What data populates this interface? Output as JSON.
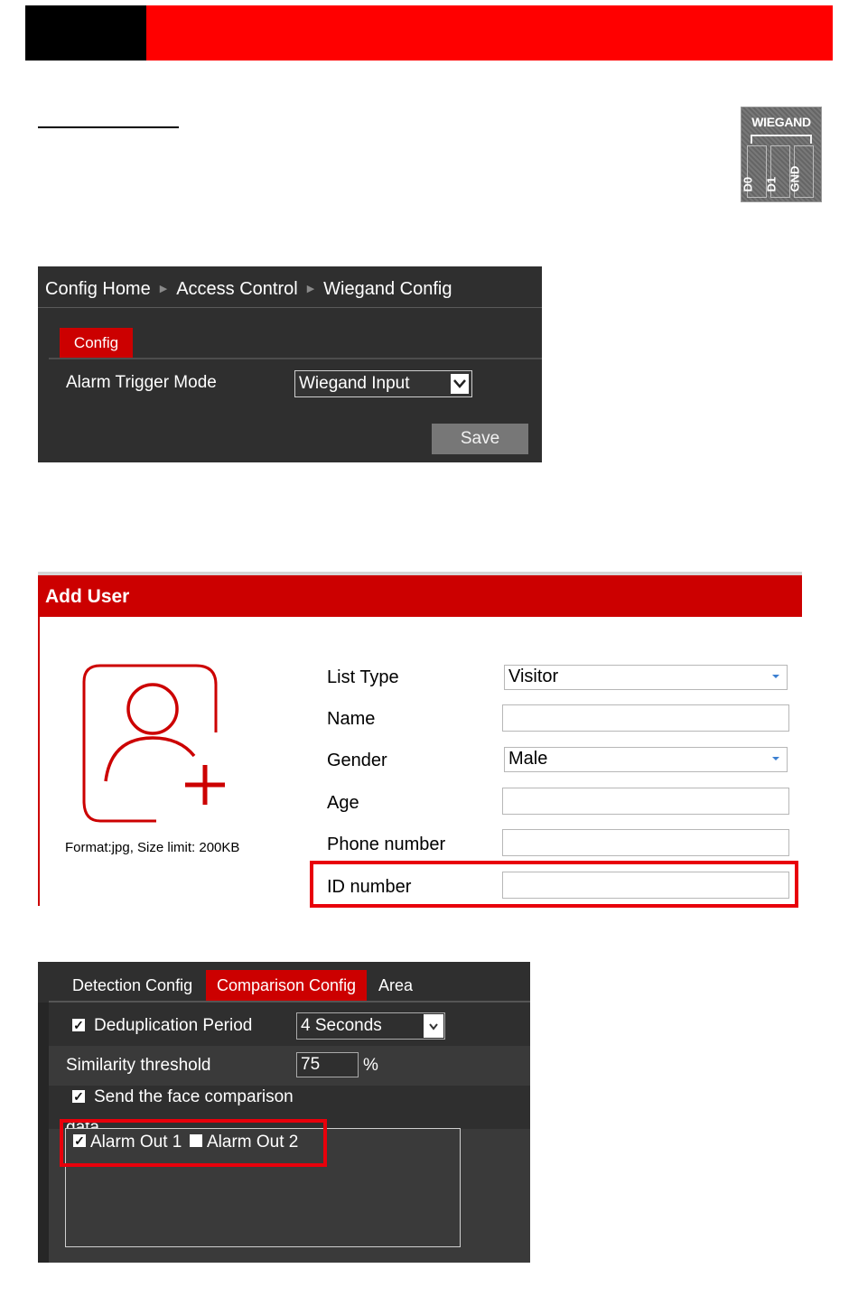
{
  "photo": {
    "title": "WIEGAND",
    "pins": [
      "D0",
      "D1",
      "GND"
    ]
  },
  "wiegand_config": {
    "breadcrumb": [
      "Config Home",
      "Access Control",
      "Wiegand Config"
    ],
    "tab_label": "Config",
    "field_label": "Alarm Trigger Mode",
    "field_value": "Wiegand Input",
    "save_label": "Save"
  },
  "add_user": {
    "title": "Add User",
    "format_note": "Format:jpg, Size limit: 200KB",
    "fields": [
      {
        "label": "List Type",
        "value": "Visitor"
      },
      {
        "label": "Name",
        "value": ""
      },
      {
        "label": "Gender",
        "value": "Male"
      },
      {
        "label": "Age",
        "value": ""
      },
      {
        "label": "Phone number",
        "value": ""
      },
      {
        "label": "ID number",
        "value": ""
      }
    ]
  },
  "comparison_config": {
    "tabs": [
      "Detection Config",
      "Comparison Config",
      "Area"
    ],
    "active_tab": "Comparison Config",
    "dedup_label": "Deduplication Period",
    "dedup_value": "4 Seconds",
    "similarity_label": "Similarity threshold",
    "similarity_value": "75",
    "similarity_unit": "%",
    "send_label": "Send the face comparison",
    "send_label_cut": "data",
    "alarm_out_1": "Alarm Out 1",
    "alarm_out_2": "Alarm Out 2"
  },
  "colors": {
    "banner_red": "#ff0000",
    "accent_red": "#cc0000",
    "highlight_red": "#e8000b",
    "panel_dark": "#2f2f2f"
  }
}
